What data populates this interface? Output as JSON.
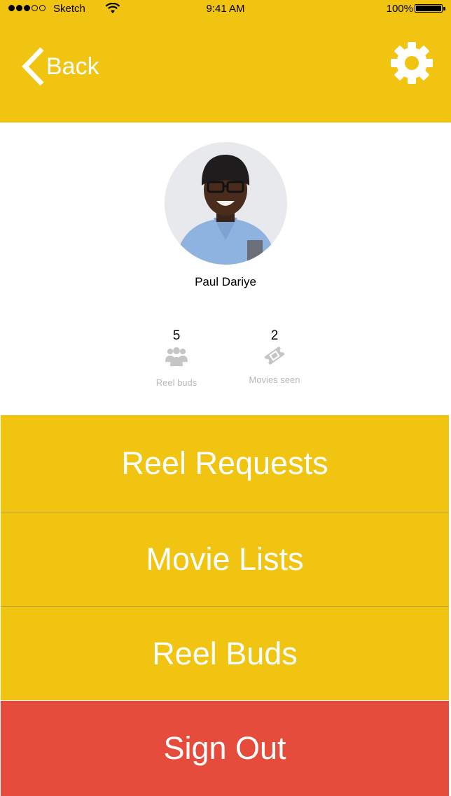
{
  "status_bar": {
    "carrier": "Sketch",
    "time": "9:41 AM",
    "battery": "100%",
    "signal_bars_filled": 3,
    "signal_bars_total": 5
  },
  "nav": {
    "back_label": "Back",
    "back_icon": "chevron-left-icon",
    "settings_icon": "gear-icon"
  },
  "profile": {
    "name": "Paul Dariye",
    "avatar": "profile-photo"
  },
  "stats": [
    {
      "count": "5",
      "label": "Reel buds",
      "icon": "people-icon"
    },
    {
      "count": "2",
      "label": "Movies seen",
      "icon": "ticket-icon"
    }
  ],
  "menu": [
    {
      "label": "Reel Requests"
    },
    {
      "label": "Movie Lists"
    },
    {
      "label": "Reel Buds"
    }
  ],
  "sign_out": {
    "label": "Sign Out"
  },
  "colors": {
    "accent": "#F0C410",
    "danger": "#E64C3C",
    "muted_text": "#B8B8B8"
  }
}
